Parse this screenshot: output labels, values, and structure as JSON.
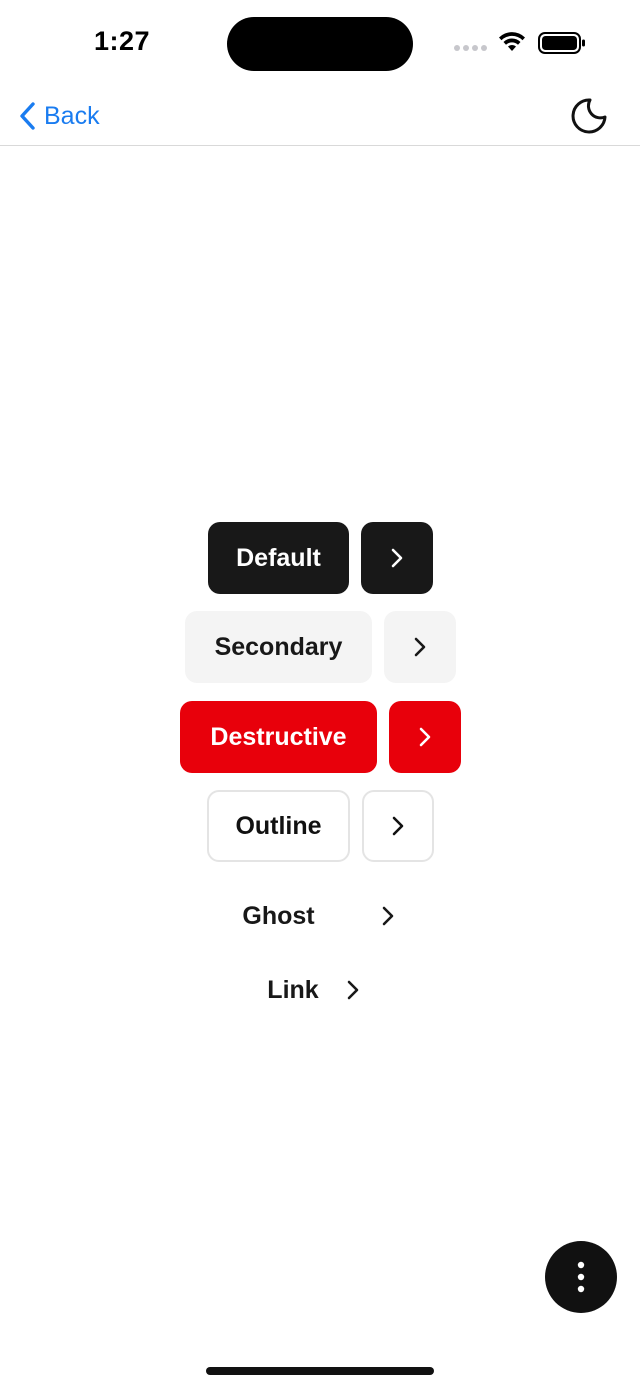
{
  "status_bar": {
    "time": "1:27"
  },
  "nav": {
    "back_label": "Back",
    "back_icon": "chevron-left-icon",
    "theme_icon": "moon-icon"
  },
  "buttons": {
    "default_label": "Default",
    "secondary_label": "Secondary",
    "destructive_label": "Destructive",
    "outline_label": "Outline",
    "ghost_label": "Ghost",
    "link_label": "Link",
    "icon": "chevron-right-icon"
  },
  "fab": {
    "icon": "more-vertical-icon"
  },
  "colors": {
    "accent": "#1a7cf0",
    "default": "#181818",
    "secondary": "#f4f4f4",
    "destructive": "#e8000b",
    "outline_border": "#e4e4e4"
  }
}
